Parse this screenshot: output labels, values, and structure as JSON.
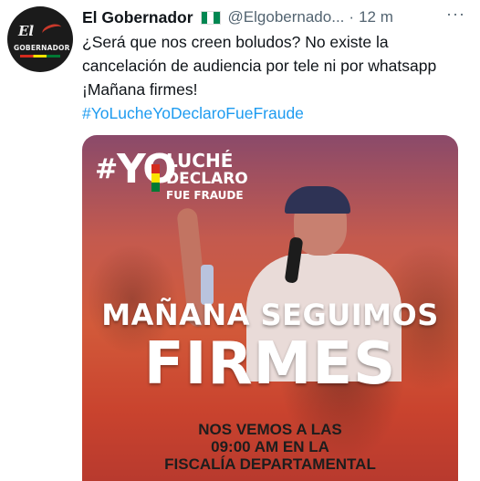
{
  "tweet": {
    "author_name": "El Gobernador",
    "author_flag_icon": "nigeria-flag-icon",
    "handle": "@Elgobernado...",
    "separator": "·",
    "time": "12 m",
    "more": "···",
    "text": "¿Será que nos creen boludos? No existe la cancelación de audiencia por tele ni por whatsapp ¡Mañana firmes!",
    "hashtag": "#YoLucheYoDeclaroFueFraude"
  },
  "avatar": {
    "line1": "El",
    "line2": "GOBERNADOR"
  },
  "media": {
    "logo_hash": "#",
    "logo_yo": "YO",
    "logo_line1": "LUCHÉ",
    "logo_line2": "DECLARO",
    "logo_line3": "FUE FRAUDE",
    "headline1": "MAÑANA SEGUIMOS",
    "headline2": "FIRMES",
    "sub1": "NOS VEMOS A LAS",
    "sub2": "09:00 AM EN LA",
    "sub3": "FISCALÍA DEPARTAMENTAL"
  },
  "colors": {
    "accent": "#1d9bf0",
    "secondary_text": "#536471",
    "bolivia_flag": [
      "#d52b1e",
      "#f9e300",
      "#007934"
    ],
    "nigeria_flag": [
      "#008751",
      "#ffffff",
      "#008751"
    ]
  }
}
